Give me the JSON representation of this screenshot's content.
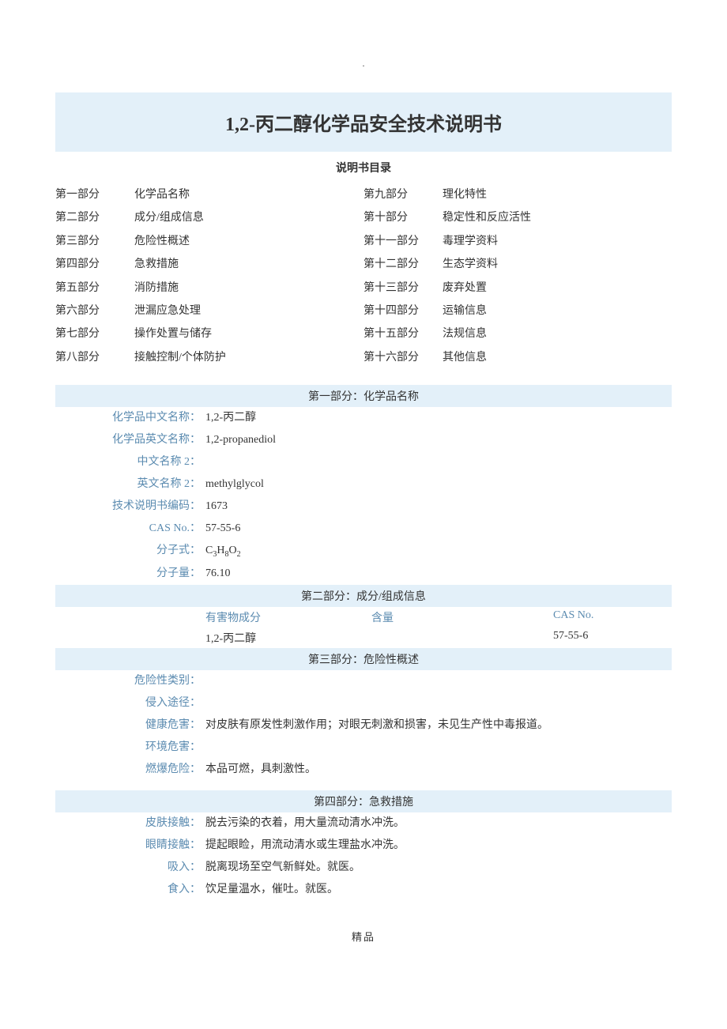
{
  "dot": ".",
  "title": "1,2-丙二醇化学品安全技术说明书",
  "toc_title": "说明书目录",
  "toc": [
    {
      "num": "第一部分",
      "txt": "化学品名称",
      "num2": "第九部分",
      "txt2": "理化特性"
    },
    {
      "num": "第二部分",
      "txt": "成分/组成信息",
      "num2": "第十部分",
      "txt2": "稳定性和反应活性"
    },
    {
      "num": "第三部分",
      "txt": "危险性概述",
      "num2": "第十一部分",
      "txt2": "毒理学资料"
    },
    {
      "num": "第四部分",
      "txt": "急救措施",
      "num2": "第十二部分",
      "txt2": "生态学资料"
    },
    {
      "num": "第五部分",
      "txt": "消防措施",
      "num2": "第十三部分",
      "txt2": "废弃处置"
    },
    {
      "num": "第六部分",
      "txt": "泄漏应急处理",
      "num2": "第十四部分",
      "txt2": "运输信息"
    },
    {
      "num": "第七部分",
      "txt": "操作处置与储存",
      "num2": "第十五部分",
      "txt2": "法规信息"
    },
    {
      "num": "第八部分",
      "txt": "接触控制/个体防护",
      "num2": "第十六部分",
      "txt2": "其他信息"
    }
  ],
  "sec1": {
    "header": "第一部分：化学品名称",
    "rows": [
      {
        "k": "化学品中文名称：",
        "v": "1,2-丙二醇"
      },
      {
        "k": "化学品英文名称：",
        "v": "1,2-propanediol"
      },
      {
        "k": "中文名称 2：",
        "v": ""
      },
      {
        "k": "英文名称 2：",
        "v": "methylglycol"
      },
      {
        "k": "技术说明书编码：",
        "v": "1673"
      },
      {
        "k": "CAS No.：",
        "v": "57-55-6"
      },
      {
        "k": "分子式：",
        "v": "C3H8O2",
        "formula": true
      },
      {
        "k": "分子量：",
        "v": "76.10"
      }
    ]
  },
  "sec2": {
    "header": "第二部分：成分/组成信息",
    "h1": "有害物成分",
    "h2": "含量",
    "h3": "CAS No.",
    "r1": "1,2-丙二醇",
    "r2": "",
    "r3": "57-55-6"
  },
  "sec3": {
    "header": "第三部分：危险性概述",
    "rows": [
      {
        "k": "危险性类别：",
        "v": ""
      },
      {
        "k": "侵入途径：",
        "v": ""
      },
      {
        "k": "健康危害：",
        "v": "对皮肤有原发性刺激作用；对眼无刺激和损害，未见生产性中毒报道。"
      },
      {
        "k": "环境危害：",
        "v": ""
      },
      {
        "k": "燃爆危险：",
        "v": "本品可燃，具刺激性。"
      }
    ]
  },
  "sec4": {
    "header": "第四部分：急救措施",
    "rows": [
      {
        "k": "皮肤接触：",
        "v": "脱去污染的衣着，用大量流动清水冲洗。"
      },
      {
        "k": "眼睛接触：",
        "v": "提起眼睑，用流动清水或生理盐水冲洗。"
      },
      {
        "k": "吸入：",
        "v": "脱离现场至空气新鲜处。就医。"
      },
      {
        "k": "食入：",
        "v": "饮足量温水，催吐。就医。"
      }
    ]
  },
  "footer": "精品"
}
